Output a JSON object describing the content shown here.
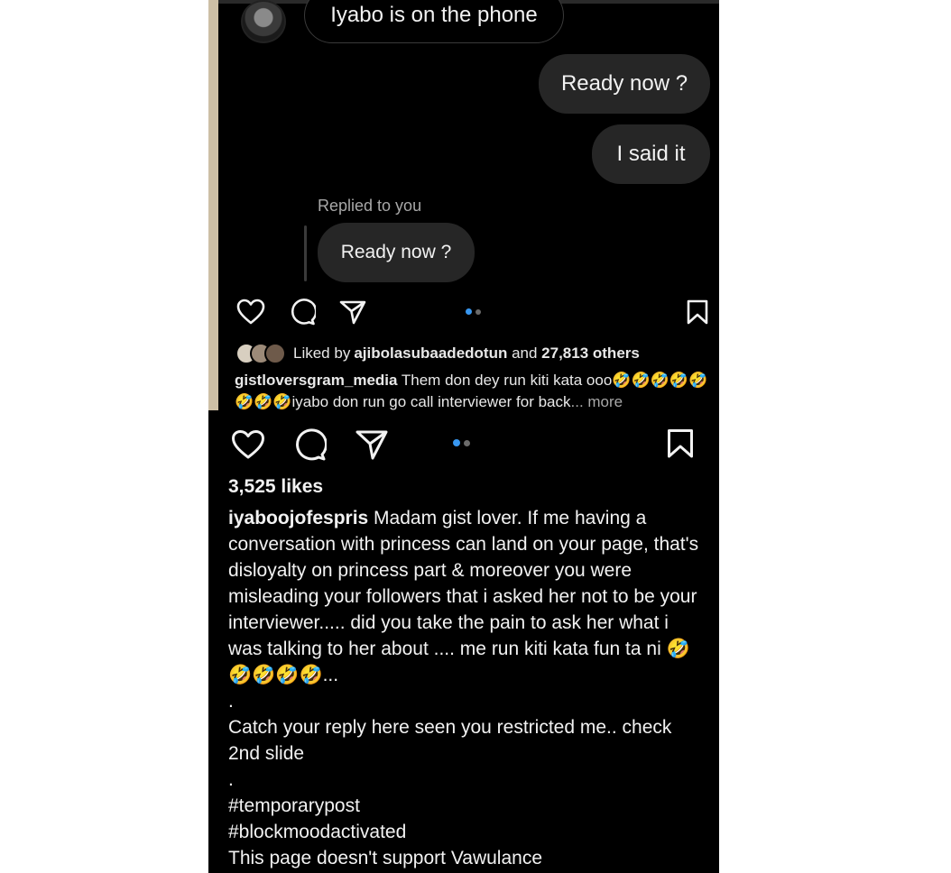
{
  "chat": {
    "received_message": "Iyabo is on the phone",
    "sent_message_1": "Ready now ?",
    "sent_message_2": "I said it",
    "replied_label": "Replied to you",
    "reply_message": "Ready now ?"
  },
  "inner_post": {
    "liked_by_prefix": "Liked by ",
    "liked_by_user": "ajibolasubaadedotun",
    "liked_by_and": " and ",
    "liked_by_count": "27,813 others",
    "caption_user": "gistloversgram_media",
    "caption_line1": " Them don dey run kiti kata ooo🤣🤣🤣🤣🤣",
    "caption_line2": "🤣🤣🤣iyabo don run go call interviewer for back",
    "more_label": "... more"
  },
  "post": {
    "likes": "3,525 likes",
    "caption_user": "iyaboojofespris",
    "caption_text": " Madam gist lover. If me having a conversation with princess can land on your page, that's disloyalty on princess part & moreover  you were misleading your followers that i asked her not to be your interviewer..... did you take the pain to ask her what i was talking to her about .... me run kiti kata fun ta ni 🤣🤣🤣🤣🤣...",
    "dot1": ".",
    "reply_line": "Catch your reply here seen you restricted me.. check 2nd slide",
    "dot2": ".",
    "hashtag1": "#temporarypost",
    "hashtag2": "#blockmoodactivated",
    "footer_line": "This page doesn't support Vawulance"
  },
  "icons": [
    "heart-icon",
    "comment-icon",
    "share-icon",
    "bookmark-icon"
  ],
  "colors": {
    "background": "#000000",
    "bubble": "#262626",
    "active_dot": "#3897f0",
    "inactive_dot": "#6b6b6b"
  }
}
